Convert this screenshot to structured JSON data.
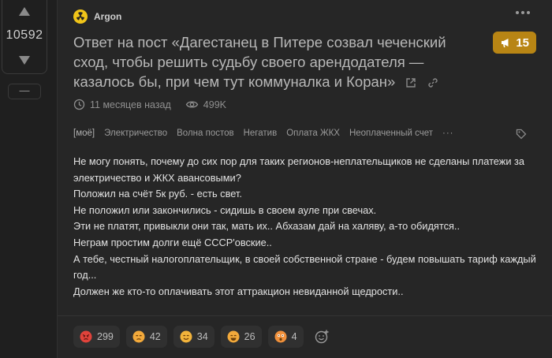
{
  "vote": {
    "count": "10592",
    "minus_label": "—"
  },
  "author": {
    "name": "Argon"
  },
  "post": {
    "title": "Ответ на пост «Дагестанец в Питере созвал чеченский сход, чтобы решить судьбу своего арендодателя — казалось бы, при чем тут коммуналка и Коран»",
    "rating_badge": "15",
    "time": "11 месяцев назад",
    "views": "499K",
    "tags": [
      "[моё]",
      "Электричество",
      "Волна постов",
      "Негатив",
      "Оплата ЖКХ",
      "Неоплаченный счет",
      "···"
    ],
    "body": [
      "Не могу понять, почему до сих пор для таких регионов-неплательщиков не сделаны платежи за электричество и ЖКХ авансовыми?",
      "Положил на счёт 5к руб. - есть свет.",
      "Не положил или закончились - сидишь в своем ауле при свечах.",
      "Эти не платят, привыкли они так, мать их.. Абхазам дай на халяву, а-то обидятся..",
      "Неграм простим долги ещё СССР'овские..",
      "А тебе, честный налогоплательщик, в своей собственной стране - будем повышать тариф каждый год...",
      "Должен же кто-то оплачивать этот аттракцион невиданной щедрости.."
    ]
  },
  "reactions": [
    {
      "icon": "angry-face-icon",
      "count": "299",
      "color": "#e0433b"
    },
    {
      "icon": "sad-face-icon",
      "count": "42",
      "color": "#f2a93b"
    },
    {
      "icon": "smiling-face-icon",
      "count": "34",
      "color": "#f2b33b"
    },
    {
      "icon": "laughing-face-icon",
      "count": "26",
      "color": "#f2a93b"
    },
    {
      "icon": "astonished-face-icon",
      "count": "4",
      "color": "#f0903b"
    }
  ],
  "colors": {
    "background": "#1f1f1f",
    "card": "#262626",
    "badge": "#b88514",
    "author_avatar": "#f0c419"
  }
}
